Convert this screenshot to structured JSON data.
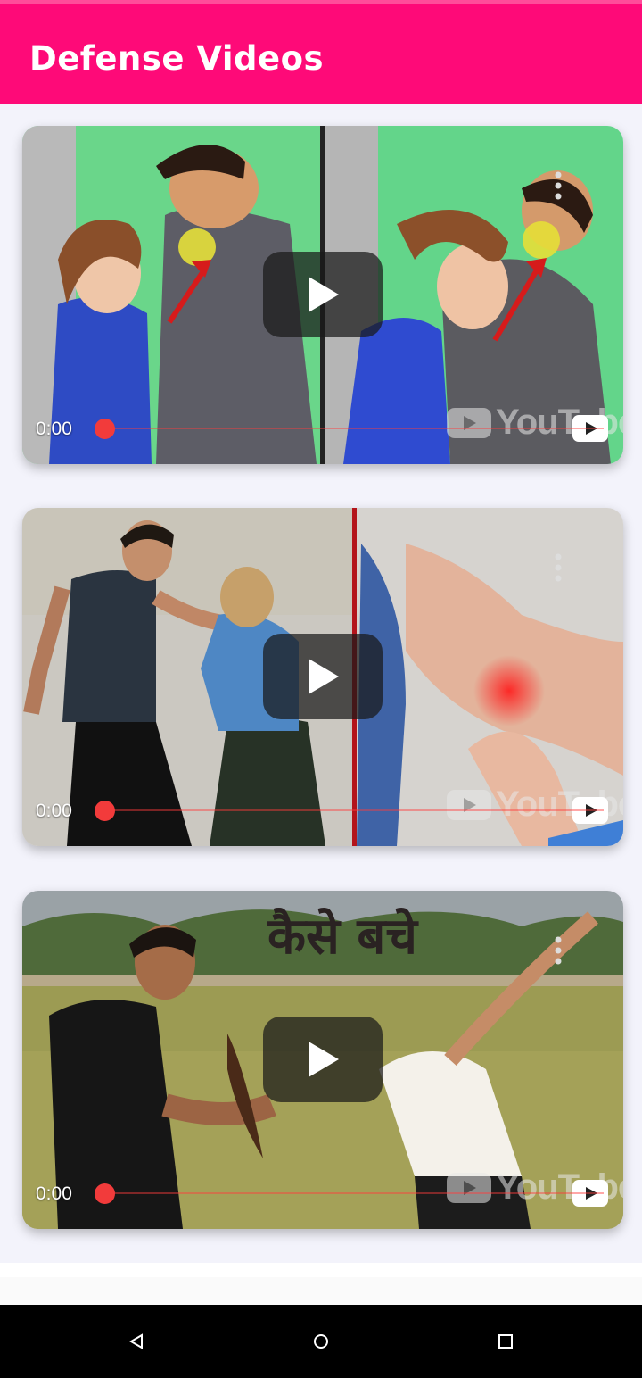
{
  "appbar": {
    "title": "Defense Videos",
    "color": "#fe0a78"
  },
  "videos": [
    {
      "time": "0:00",
      "watermark": "YouTube",
      "progress": 0
    },
    {
      "time": "0:00",
      "watermark": "YouTube",
      "progress": 0
    },
    {
      "time": "0:00",
      "watermark": "YouTube",
      "progress": 0,
      "overlay_text": "कैसे बचे"
    }
  ],
  "navbar": {
    "buttons": [
      "back-icon",
      "home-icon",
      "recents-icon"
    ]
  }
}
